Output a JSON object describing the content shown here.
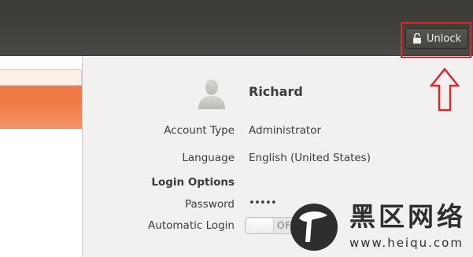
{
  "header": {
    "unlock_label": "Unlock",
    "lock_icon": "unlocked-padlock-icon"
  },
  "annotation": {
    "color": "#d9282e"
  },
  "user": {
    "name": "Richard",
    "avatar_icon": "default-user-avatar-icon"
  },
  "details": {
    "account_type_label": "Account Type",
    "account_type_value": "Administrator",
    "language_label": "Language",
    "language_value": "English (United States)",
    "login_options_title": "Login Options",
    "password_label": "Password",
    "password_value": "•••••",
    "automatic_login_label": "Automatic Login",
    "automatic_login_state": "OFF"
  },
  "colors": {
    "selection_orange": "#f07a47",
    "header_dark": "#3b3a36"
  },
  "watermark": {
    "chinese_text": "黑区网络",
    "url": "www.heiqu.com"
  }
}
